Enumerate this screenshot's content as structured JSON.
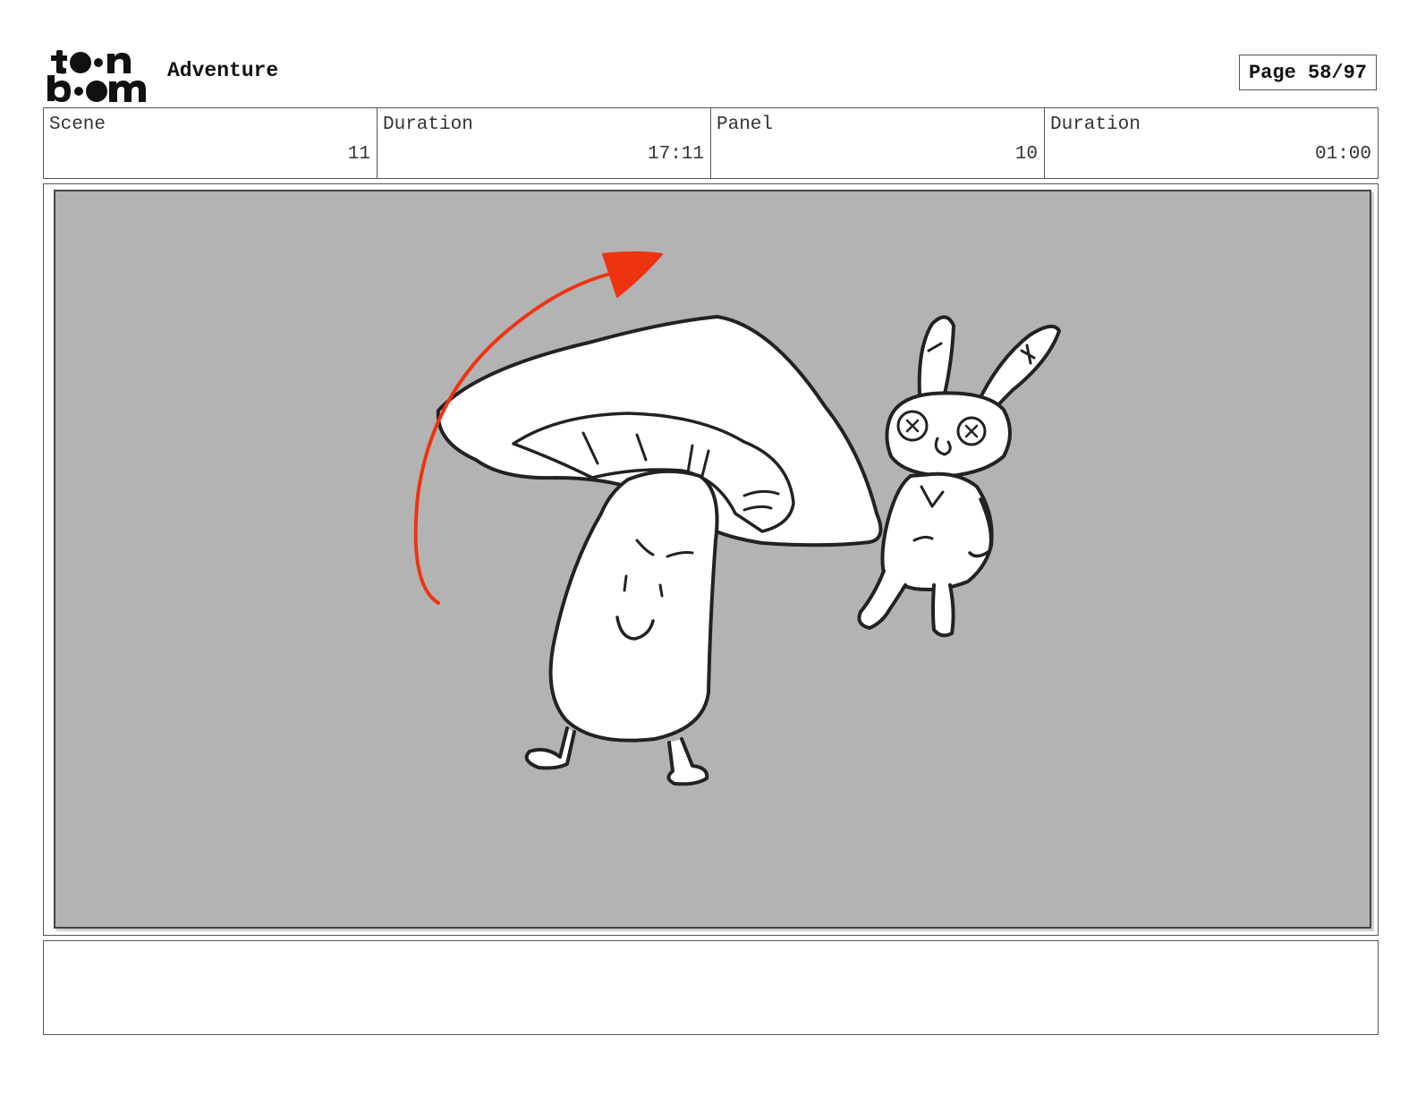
{
  "header": {
    "logo": {
      "name": "toon-boom-logo",
      "line1": "toon",
      "line2": "boom"
    },
    "project_title": "Adventure",
    "page_label": "Page 58/97"
  },
  "info": [
    {
      "label": "Scene",
      "value": "11"
    },
    {
      "label": "Duration",
      "value": "17:11"
    },
    {
      "label": "Panel",
      "value": "10"
    },
    {
      "label": "Duration",
      "value": "01:00"
    }
  ],
  "panel": {
    "background_color": "#b3b3b3",
    "arrow_color": "#ee3311",
    "ink_color": "#222222",
    "fill_color": "#ffffff"
  },
  "notes": {
    "text": ""
  }
}
